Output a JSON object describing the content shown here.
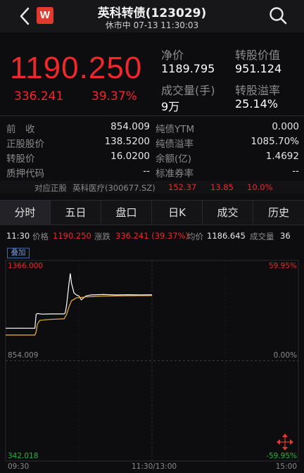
{
  "header": {
    "title": "英科转债(123029)",
    "subtitle": "休市中 07-13 11:30:03",
    "logo_letter": "W"
  },
  "quote": {
    "price": "1190.250",
    "change": "336.241",
    "change_pct": "39.37%"
  },
  "stats": [
    {
      "label": "净价",
      "value": "1189.795"
    },
    {
      "label": "转股价值",
      "value": "951.124"
    },
    {
      "label": "成交量(手)",
      "value": "9万"
    },
    {
      "label": "转股溢率",
      "value": "25.14%"
    }
  ],
  "details": [
    {
      "label": "前　收",
      "value": "854.009"
    },
    {
      "label": "纯债YTM",
      "value": "0.000"
    },
    {
      "label": "正股股价",
      "value": "138.5200"
    },
    {
      "label": "纯债溢率",
      "value": "1085.70%"
    },
    {
      "label": "转股价",
      "value": "16.0200"
    },
    {
      "label": "余额(亿)",
      "value": "1.4692"
    },
    {
      "label": "质押代码",
      "value": "--"
    },
    {
      "label": "标准券率",
      "value": "--"
    }
  ],
  "underlying": {
    "label": "对应正股",
    "name": "英科医疗(300677.SZ)",
    "price": "152.37",
    "change": "13.85",
    "change_pct": "10.0%"
  },
  "tabs": [
    "分时",
    "五日",
    "盘口",
    "日K",
    "成交",
    "历史"
  ],
  "info_bar": {
    "time": "11:30",
    "price_label": "价格",
    "price": "1190.250",
    "change_label": "涨跌",
    "change": "336.241 (39.37%)",
    "avg_label": "均价",
    "avg": "1186.645",
    "vol_label": "成交量",
    "vol": "36"
  },
  "chart": {
    "overlay_label": "叠加",
    "y_top": "1366.000",
    "y_mid": "854.009",
    "y_bottom": "342.018",
    "pct_top": "59.95%",
    "pct_mid": "0.00%",
    "pct_bottom": "-59.95%",
    "x_start": "09:30",
    "x_mid": "11:30/13:00",
    "x_end": "15:00"
  },
  "colors": {
    "up": "#f0282a",
    "price_line": "#ffffff",
    "avg_line": "#f0b43c",
    "accent": "#e23a2e"
  },
  "chart_data": {
    "type": "line",
    "ylim": [
      342.018,
      1366.0
    ],
    "xlabel": "",
    "ylabel": "",
    "x_ticks": [
      "09:30",
      "11:30/13:00",
      "15:00"
    ],
    "series": [
      {
        "values": [
          [
            0,
            1020
          ],
          [
            6,
            1020
          ],
          [
            12,
            1020
          ],
          [
            18,
            1020
          ],
          [
            24,
            1020
          ],
          [
            25,
            1090
          ],
          [
            26,
            1095
          ],
          [
            30,
            1092
          ],
          [
            36,
            1093
          ],
          [
            48,
            1093
          ],
          [
            49,
            1100
          ],
          [
            50,
            1140
          ],
          [
            52,
            1250
          ],
          [
            53,
            1300
          ],
          [
            54,
            1250
          ],
          [
            56,
            1200
          ],
          [
            58,
            1190
          ],
          [
            60,
            1185
          ],
          [
            62,
            1165
          ],
          [
            64,
            1175
          ],
          [
            66,
            1185
          ],
          [
            70,
            1190
          ],
          [
            80,
            1192
          ],
          [
            90,
            1190
          ],
          [
            100,
            1191
          ],
          [
            110,
            1190
          ],
          [
            120,
            1190.25
          ]
        ]
      },
      {
        "values": [
          [
            0,
            985
          ],
          [
            12,
            985
          ],
          [
            22,
            985
          ],
          [
            24,
            985
          ],
          [
            25,
            1000
          ],
          [
            26,
            1040
          ],
          [
            28,
            1060
          ],
          [
            36,
            1065
          ],
          [
            48,
            1068
          ],
          [
            50,
            1090
          ],
          [
            52,
            1130
          ],
          [
            54,
            1160
          ],
          [
            58,
            1175
          ],
          [
            66,
            1180
          ],
          [
            80,
            1184
          ],
          [
            100,
            1186
          ],
          [
            120,
            1186.645
          ]
        ]
      }
    ]
  }
}
